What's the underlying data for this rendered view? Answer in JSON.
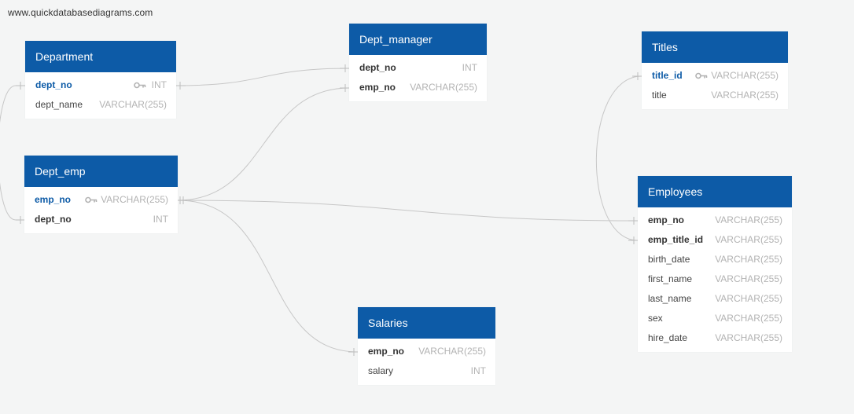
{
  "watermark": "www.quickdatabasediagrams.com",
  "colors": {
    "header": "#0d5ba7",
    "pk_text": "#0d5ba7",
    "type_text": "#b3b3b3",
    "link": "#c7c7c7"
  },
  "tables": {
    "department": {
      "title": "Department",
      "fields": [
        {
          "name": "dept_no",
          "type": "INT",
          "pk": true
        },
        {
          "name": "dept_name",
          "type": "VARCHAR(255)"
        }
      ]
    },
    "dept_manager": {
      "title": "Dept_manager",
      "fields": [
        {
          "name": "dept_no",
          "type": "INT",
          "bold": true
        },
        {
          "name": "emp_no",
          "type": "VARCHAR(255)",
          "bold": true
        }
      ]
    },
    "titles": {
      "title": "Titles",
      "fields": [
        {
          "name": "title_id",
          "type": "VARCHAR(255)",
          "pk": true
        },
        {
          "name": "title",
          "type": "VARCHAR(255)"
        }
      ]
    },
    "dept_emp": {
      "title": "Dept_emp",
      "fields": [
        {
          "name": "emp_no",
          "type": "VARCHAR(255)",
          "pk": true
        },
        {
          "name": "dept_no",
          "type": "INT",
          "bold": true
        }
      ]
    },
    "employees": {
      "title": "Employees",
      "fields": [
        {
          "name": "emp_no",
          "type": "VARCHAR(255)",
          "bold": true
        },
        {
          "name": "emp_title_id",
          "type": "VARCHAR(255)",
          "bold": true
        },
        {
          "name": "birth_date",
          "type": "VARCHAR(255)"
        },
        {
          "name": "first_name",
          "type": "VARCHAR(255)"
        },
        {
          "name": "last_name",
          "type": "VARCHAR(255)"
        },
        {
          "name": "sex",
          "type": "VARCHAR(255)"
        },
        {
          "name": "hire_date",
          "type": "VARCHAR(255)"
        }
      ]
    },
    "salaries": {
      "title": "Salaries",
      "fields": [
        {
          "name": "emp_no",
          "type": "VARCHAR(255)",
          "bold": true
        },
        {
          "name": "salary",
          "type": "INT"
        }
      ]
    }
  }
}
